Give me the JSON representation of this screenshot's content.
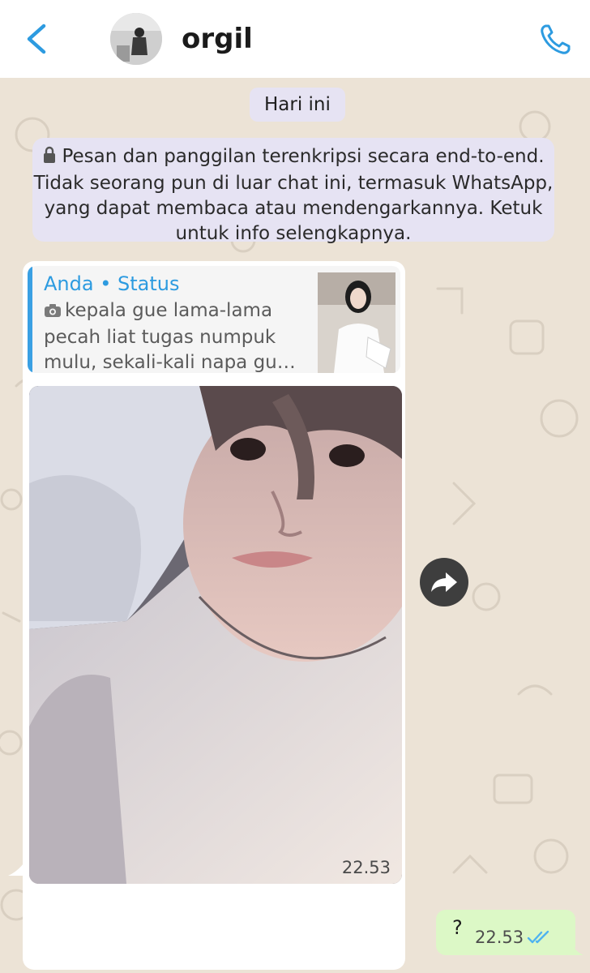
{
  "header": {
    "contact_name": "orgil",
    "back_icon": "chevron-left-icon",
    "call_icon": "phone-icon",
    "accent_color": "#2d9be0"
  },
  "chat": {
    "date_chip": "Hari ini",
    "encryption_notice": "Pesan dan panggilan terenkripsi secara end-to-end. Tidak seorang pun di luar chat ini, termasuk WhatsApp, yang dapat membaca atau mendengarkannya. Ketuk untuk info selengkapnya.",
    "incoming": {
      "reply_title": "Anda • Status",
      "reply_text": "kepala gue lama-lama pecah liat tugas numpuk mulu, sekali-kali napa gu…",
      "reply_icon": "camera-icon",
      "photo_time": "22.53"
    },
    "outgoing": {
      "text": "?",
      "time": "22.53",
      "status_icon": "double-check-icon"
    }
  }
}
